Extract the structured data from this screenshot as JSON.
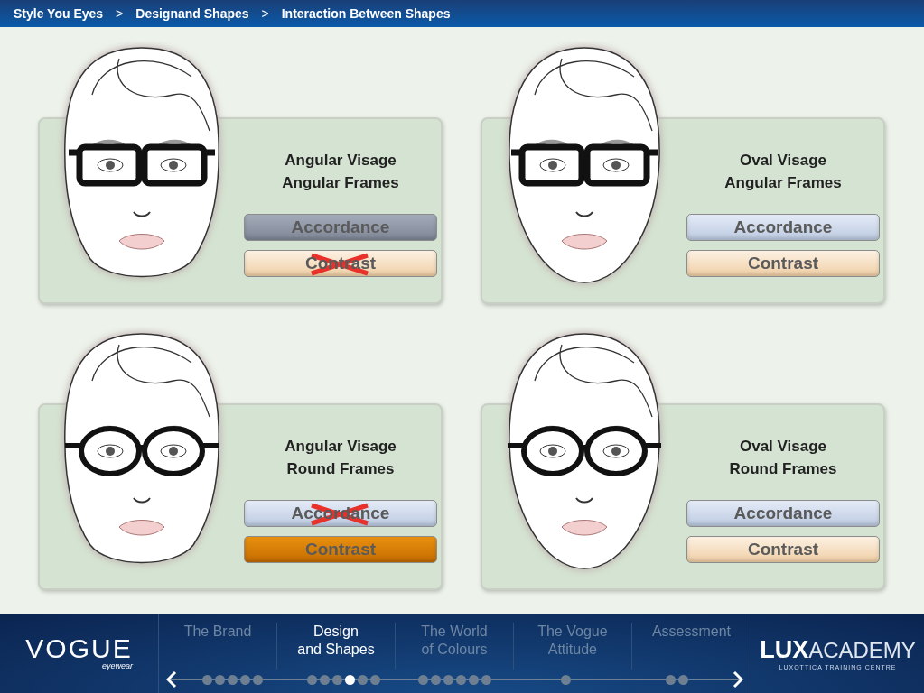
{
  "breadcrumb": [
    {
      "kind": "crumb",
      "text": "Style You Eyes"
    },
    {
      "kind": "sep",
      "text": ">"
    },
    {
      "kind": "crumb",
      "text": "Designand Shapes"
    },
    {
      "kind": "sep",
      "text": ">"
    },
    {
      "kind": "crumb",
      "text": "Interaction Between Shapes"
    }
  ],
  "cards": [
    {
      "title_lines": [
        "Angular Visage",
        "Angular Frames"
      ],
      "face": {
        "kind": "angular"
      },
      "frames": {
        "kind": "angular"
      },
      "buttons": [
        {
          "kind": "accordance",
          "label": "Accordance",
          "selected": true,
          "crossed": false
        },
        {
          "kind": "contrast",
          "label": "Contrast",
          "selected": false,
          "crossed": true
        }
      ]
    },
    {
      "title_lines": [
        "Oval Visage",
        "Angular Frames"
      ],
      "face": {
        "kind": "oval"
      },
      "frames": {
        "kind": "angular"
      },
      "buttons": [
        {
          "kind": "accordance",
          "label": "Accordance",
          "selected": false,
          "crossed": false
        },
        {
          "kind": "contrast",
          "label": "Contrast",
          "selected": false,
          "crossed": false
        }
      ]
    },
    {
      "title_lines": [
        "Angular Visage",
        "Round Frames"
      ],
      "face": {
        "kind": "angular"
      },
      "frames": {
        "kind": "round"
      },
      "buttons": [
        {
          "kind": "accordance",
          "label": "Accordance",
          "selected": false,
          "crossed": true
        },
        {
          "kind": "contrast",
          "label": "Contrast",
          "selected": true,
          "crossed": false
        }
      ]
    },
    {
      "title_lines": [
        "Oval Visage",
        "Round Frames"
      ],
      "face": {
        "kind": "oval"
      },
      "frames": {
        "kind": "round"
      },
      "buttons": [
        {
          "kind": "accordance",
          "label": "Accordance",
          "selected": false,
          "crossed": false
        },
        {
          "kind": "contrast",
          "label": "Contrast",
          "selected": false,
          "crossed": false
        }
      ]
    }
  ],
  "footer": {
    "brand": {
      "name": "VOGUE",
      "sub": "eyewear"
    },
    "sections": [
      {
        "label": "The Brand",
        "selected": false,
        "dots": [
          {
            "selected": false
          },
          {
            "selected": false
          },
          {
            "selected": false
          },
          {
            "selected": false
          },
          {
            "selected": false
          }
        ]
      },
      {
        "label": "Design\nand Shapes",
        "selected": true,
        "dots": [
          {
            "selected": false
          },
          {
            "selected": false
          },
          {
            "selected": false
          },
          {
            "selected": true
          },
          {
            "selected": false
          },
          {
            "selected": false
          }
        ]
      },
      {
        "label": "The World of Colours",
        "selected": false,
        "dots": [
          {
            "selected": false
          },
          {
            "selected": false
          },
          {
            "selected": false
          },
          {
            "selected": false
          },
          {
            "selected": false
          },
          {
            "selected": false
          }
        ]
      },
      {
        "label": "The Vogue Attitude",
        "selected": false,
        "dots": [
          {
            "selected": false
          }
        ]
      },
      {
        "label": "Assessment",
        "selected": false,
        "dots": [
          {
            "selected": false
          },
          {
            "selected": false
          }
        ]
      }
    ],
    "academy": {
      "lux": "LUX",
      "name": "ACADEMY",
      "sub": "LUXOTTICA TRAINING CENTRE"
    }
  }
}
